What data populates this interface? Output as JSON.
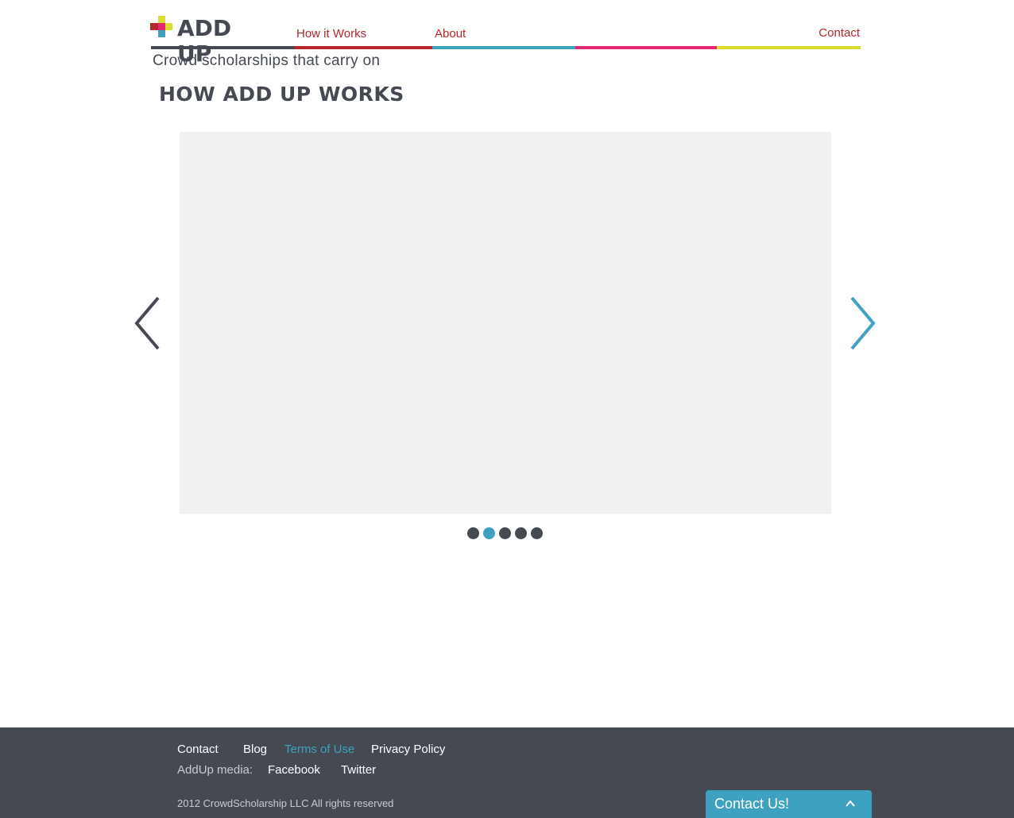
{
  "brand": {
    "name": "ADD UP",
    "tagline": "Crowd scholarships that carry on",
    "colors": [
      "#b5262c",
      "#3ea1bf",
      "#e4266f",
      "#d9de2c",
      "#454a52"
    ]
  },
  "nav": {
    "items": [
      {
        "label": "How it Works"
      },
      {
        "label": "About"
      },
      {
        "label": "Contact"
      }
    ]
  },
  "main": {
    "title": "HOW ADD UP WORKS",
    "carousel": {
      "prev_icon": "chevron-left-icon",
      "next_icon": "chevron-right-icon",
      "slide_count": 5,
      "active_index": 1
    }
  },
  "footer": {
    "links": [
      "Contact",
      "Blog",
      "Terms of Use",
      "Privacy Policy"
    ],
    "active_link": "Terms of Use",
    "media_label": "AddUp media:",
    "media_links": [
      "Facebook",
      "Twitter"
    ],
    "copyright": "2012 CrowdScholarship LLC All rights reserved"
  },
  "contact_widget": {
    "label": "Contact Us!",
    "icon": "chevron-up-icon"
  }
}
